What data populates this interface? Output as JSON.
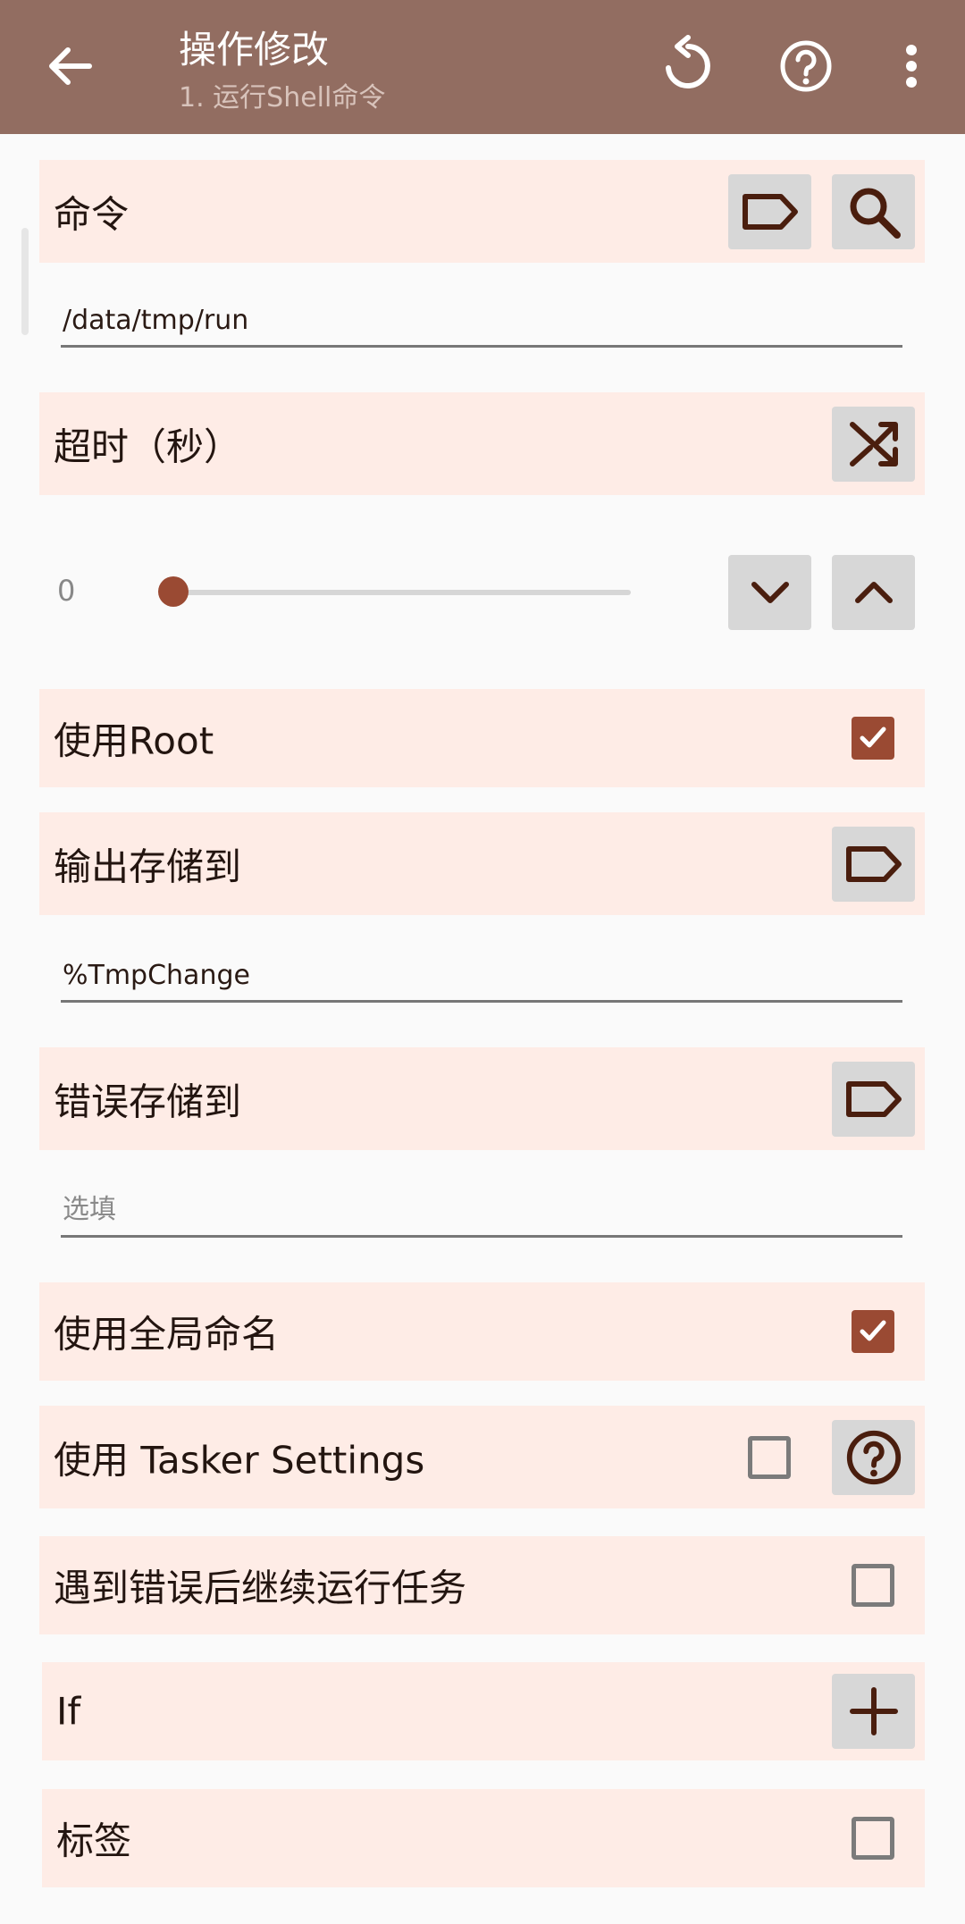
{
  "appbar": {
    "title": "操作修改",
    "subtitle": "1. 运行Shell命令",
    "icons": [
      "back-arrow-icon",
      "revert-icon",
      "help-icon",
      "more-vert-icon"
    ]
  },
  "command": {
    "label": "命令",
    "value": "/data/tmp/run",
    "buttons": [
      "tag-icon",
      "search-icon"
    ]
  },
  "timeout": {
    "label": "超时（秒）",
    "value": "0",
    "buttons": [
      "shuffle-icon",
      "chevron-down-icon",
      "chevron-up-icon"
    ]
  },
  "use_root": {
    "label": "使用Root",
    "checked": true
  },
  "output_store": {
    "label": "输出存储到",
    "value": "%TmpChange"
  },
  "error_store": {
    "label": "错误存储到",
    "placeholder": "选填"
  },
  "use_global": {
    "label": "使用全局命名",
    "checked": true
  },
  "tasker_settings": {
    "label": "使用 Tasker Settings",
    "checked": false
  },
  "continue_on_error": {
    "label": "遇到错误后继续运行任务",
    "checked": false
  },
  "if_row": {
    "label": "If"
  },
  "tag_row": {
    "label": "标签",
    "checked": false
  },
  "colors": {
    "appbar": "#926d61",
    "row_background": "#feece6",
    "accent": "#9a4a33",
    "button_background": "#d7d7d7",
    "icon": "#4a1e0e"
  }
}
